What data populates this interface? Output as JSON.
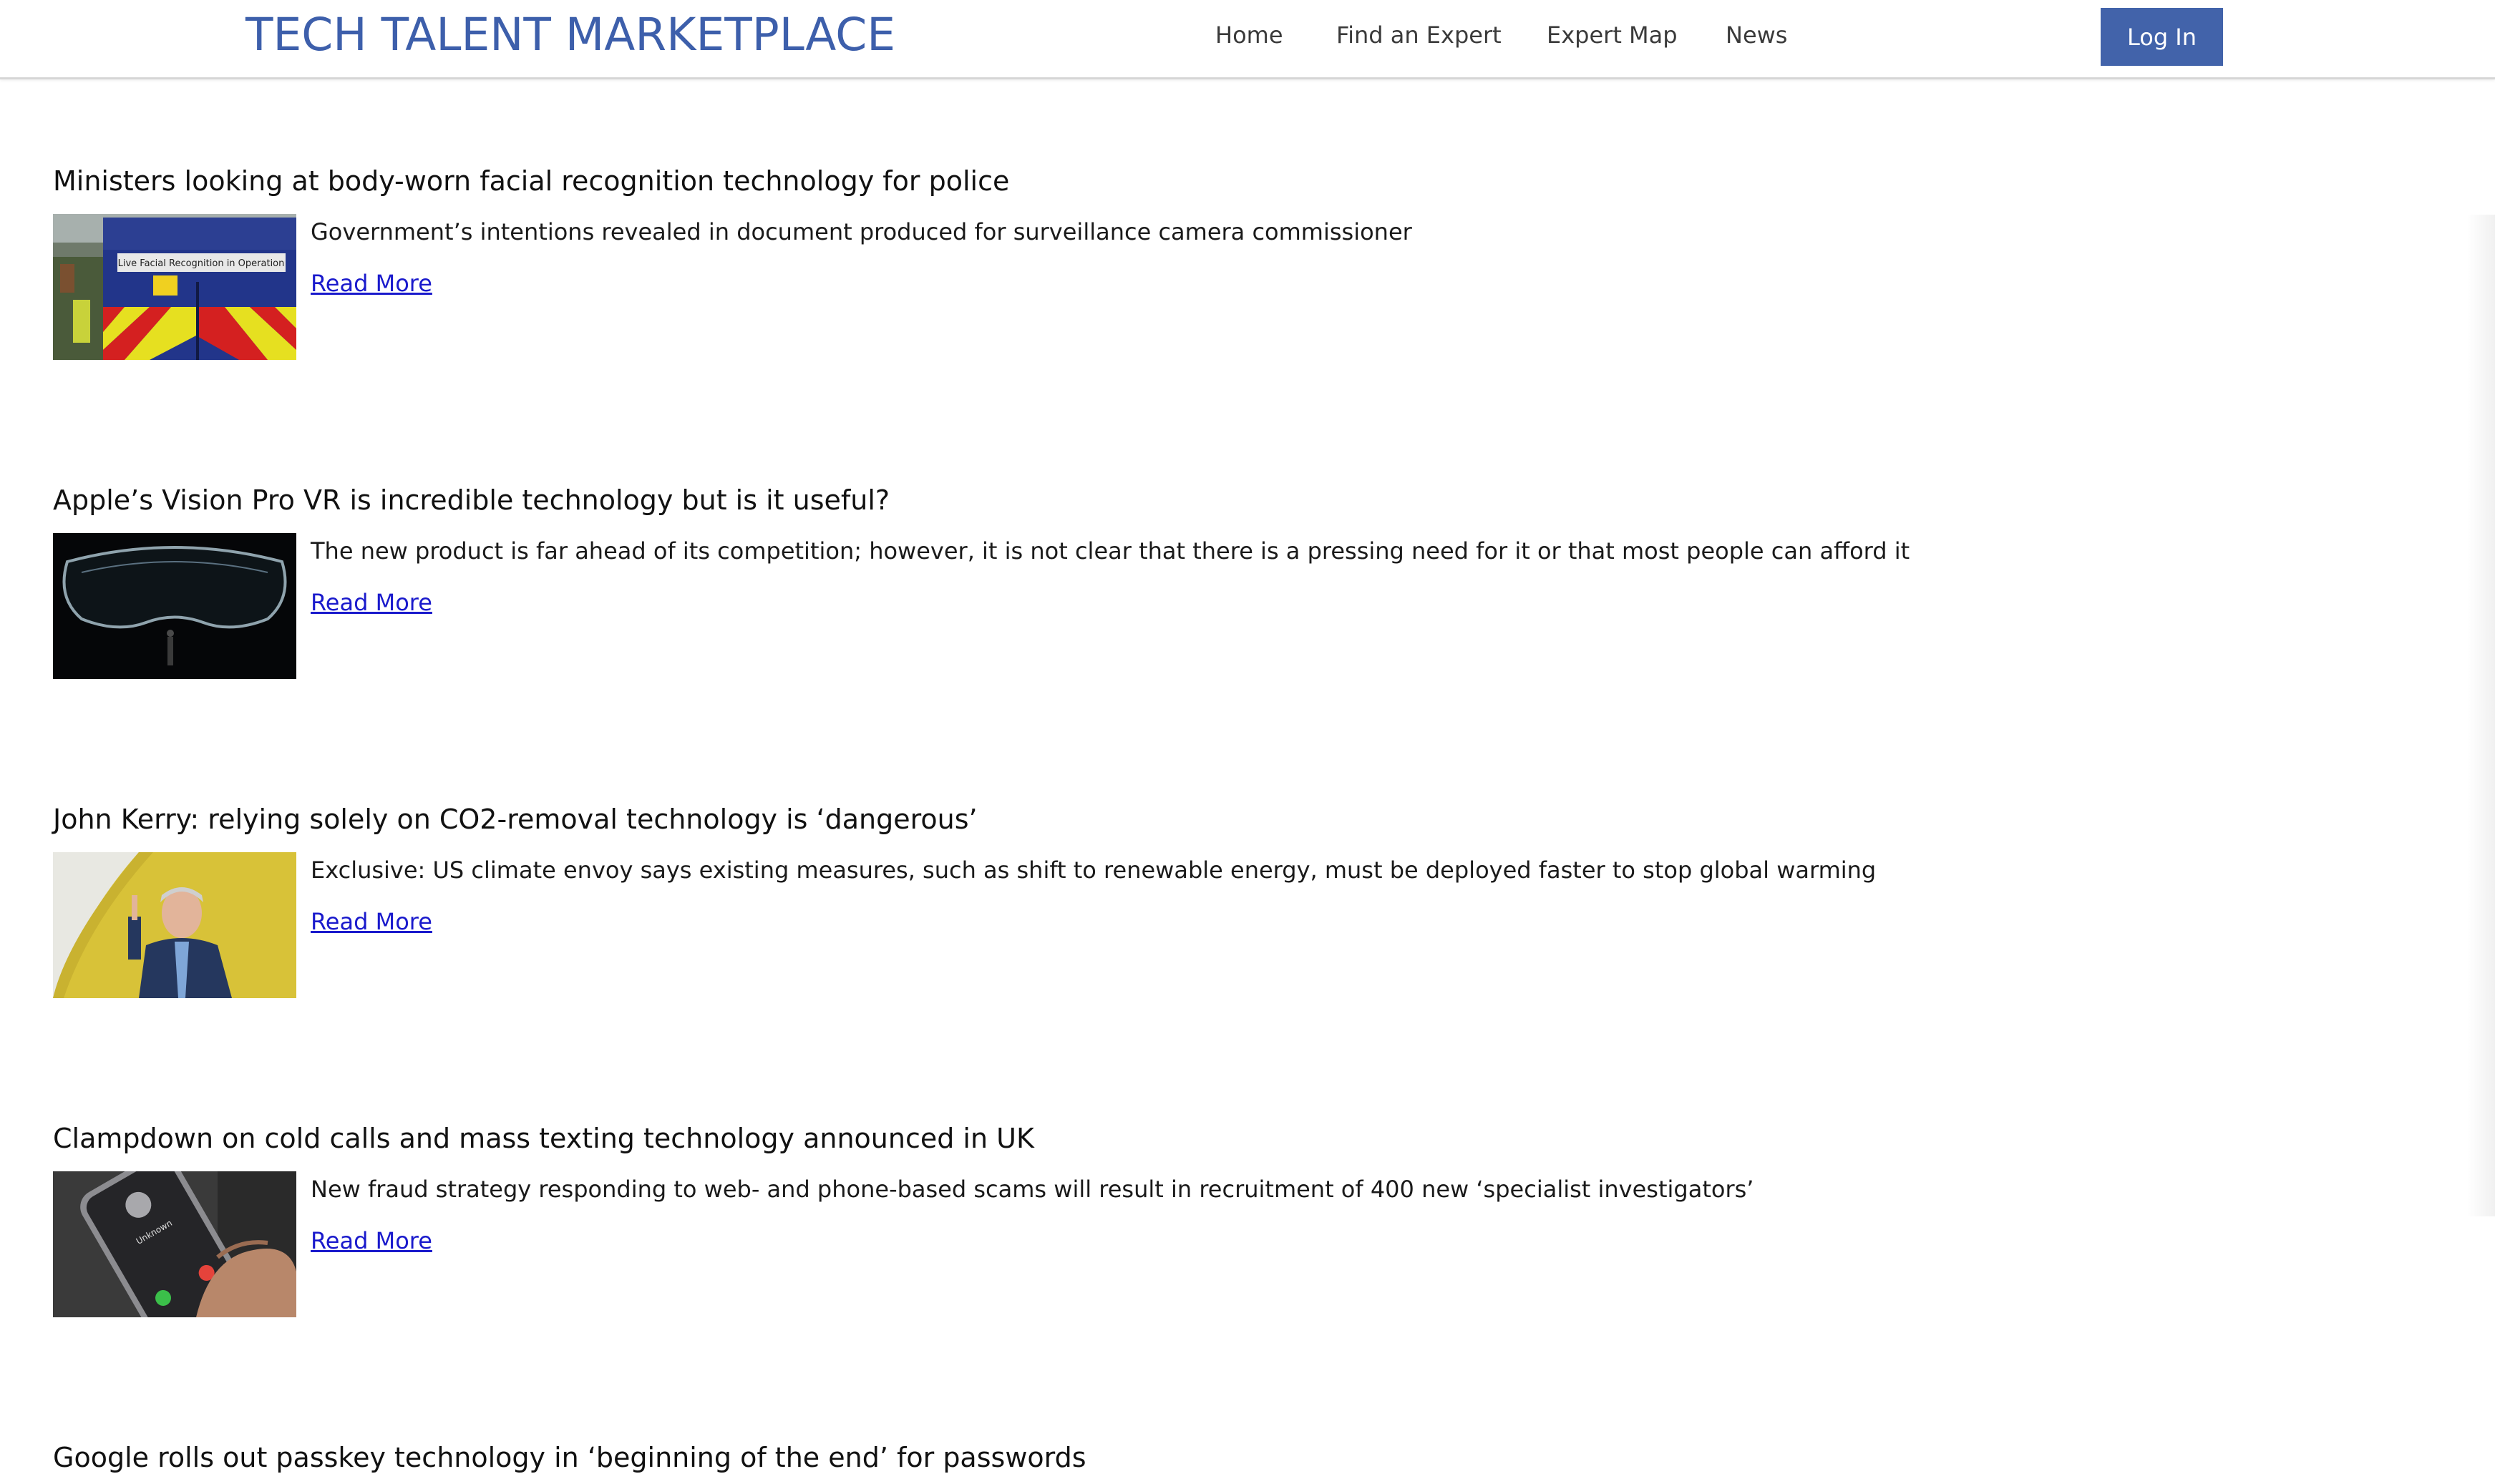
{
  "header": {
    "brand": "TECH TALENT MARKETPLACE",
    "nav": [
      "Home",
      "Find an Expert",
      "Expert Map",
      "News"
    ],
    "login_label": "Log In"
  },
  "colors": {
    "brand": "#3d5fab",
    "button": "#4263aa",
    "link": "#1a1acc"
  },
  "articles": [
    {
      "title": "Ministers looking at body-worn facial recognition technology for police",
      "summary": "Government’s intentions revealed in document produced for surveillance camera commissioner",
      "read_more": "Read More",
      "image_sign": "Live Facial Recognition in Operation"
    },
    {
      "title": "Apple’s Vision Pro VR is incredible technology but is it useful?",
      "summary": "The new product is far ahead of its competition; however, it is not clear that there is a pressing need for it or that most people can afford it",
      "read_more": "Read More"
    },
    {
      "title": "John Kerry: relying solely on CO2-removal technology is ‘dangerous’",
      "summary": "Exclusive: US climate envoy says existing measures, such as shift to renewable energy, must be deployed faster to stop global warming",
      "read_more": "Read More"
    },
    {
      "title": "Clampdown on cold calls and mass texting technology announced in UK",
      "summary": "New fraud strategy responding to web- and phone-based scams will result in recruitment of 400 new ‘specialist investigators’",
      "read_more": "Read More",
      "image_caller": "Unknown"
    },
    {
      "title": "Google rolls out passkey technology in ‘beginning of the end’ for passwords"
    }
  ]
}
